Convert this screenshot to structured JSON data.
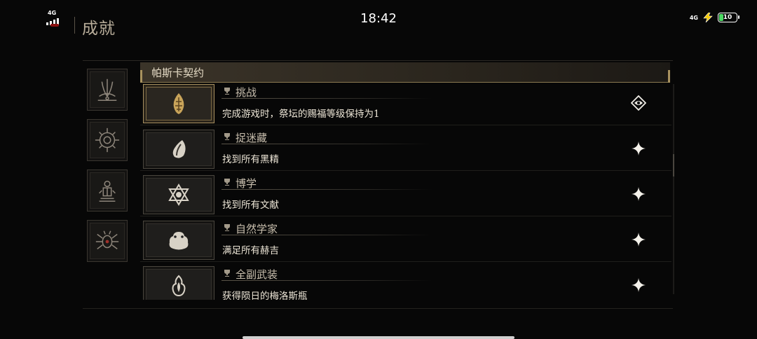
{
  "status_bar": {
    "time": "18:42",
    "network_left": "4G",
    "network_right": "4G",
    "battery": "10",
    "battery_color": "#4cd964"
  },
  "page_title": "成就",
  "categories": [
    {
      "icon": "pillar-claw-icon"
    },
    {
      "icon": "sun-compass-icon"
    },
    {
      "icon": "idol-altar-icon"
    },
    {
      "icon": "spider-eye-icon"
    }
  ],
  "section": {
    "title": "帕斯卡契约"
  },
  "achievements": [
    {
      "name": "挑战",
      "description": "完成游戏时，祭坛的赐福等级保持为1",
      "icon": "flame-sigil-icon",
      "status_icon": "eye-emblem-icon",
      "unlocked": true
    },
    {
      "name": "捉迷藏",
      "description": "找到所有黑精",
      "icon": "leaf-spirit-icon",
      "status_icon": "sparkle-icon",
      "unlocked": false
    },
    {
      "name": "博学",
      "description": "找到所有文献",
      "icon": "hexagram-icon",
      "status_icon": "sparkle-icon",
      "unlocked": false
    },
    {
      "name": "自然学家",
      "description": "满足所有赫吉",
      "icon": "toad-icon",
      "status_icon": "sparkle-icon",
      "unlocked": false
    },
    {
      "name": "全副武装",
      "description": "获得陨日的梅洛斯瓶",
      "icon": "flame-vial-icon",
      "status_icon": "sparkle-icon",
      "unlocked": false
    }
  ],
  "colors": {
    "accent_gold": "#a89060",
    "text_light": "#ece5d6"
  }
}
